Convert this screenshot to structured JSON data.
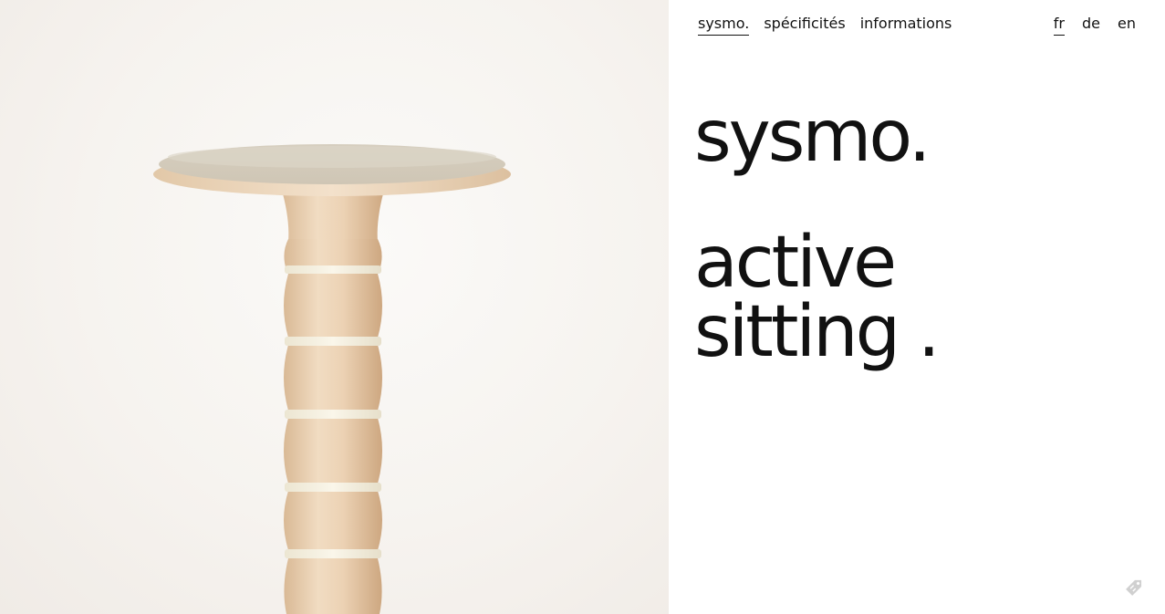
{
  "nav": {
    "items": [
      {
        "label": "sysmo.",
        "active": true
      },
      {
        "label": "spécificités",
        "active": false
      },
      {
        "label": "informations",
        "active": false
      }
    ]
  },
  "languages": {
    "items": [
      {
        "label": "fr",
        "active": true
      },
      {
        "label": "de",
        "active": false
      },
      {
        "label": "en",
        "active": false
      }
    ]
  },
  "hero": {
    "title": "sysmo.",
    "tagline_line1": "active",
    "tagline_line2": "sitting ."
  },
  "icons": {
    "feedback": "feedback-tag-icon"
  },
  "colors": {
    "text": "#111111",
    "background": "#ffffff",
    "photo_background": "#f6f3ef",
    "wood": "#e8cfb0",
    "seat": "#d8d0c0"
  }
}
